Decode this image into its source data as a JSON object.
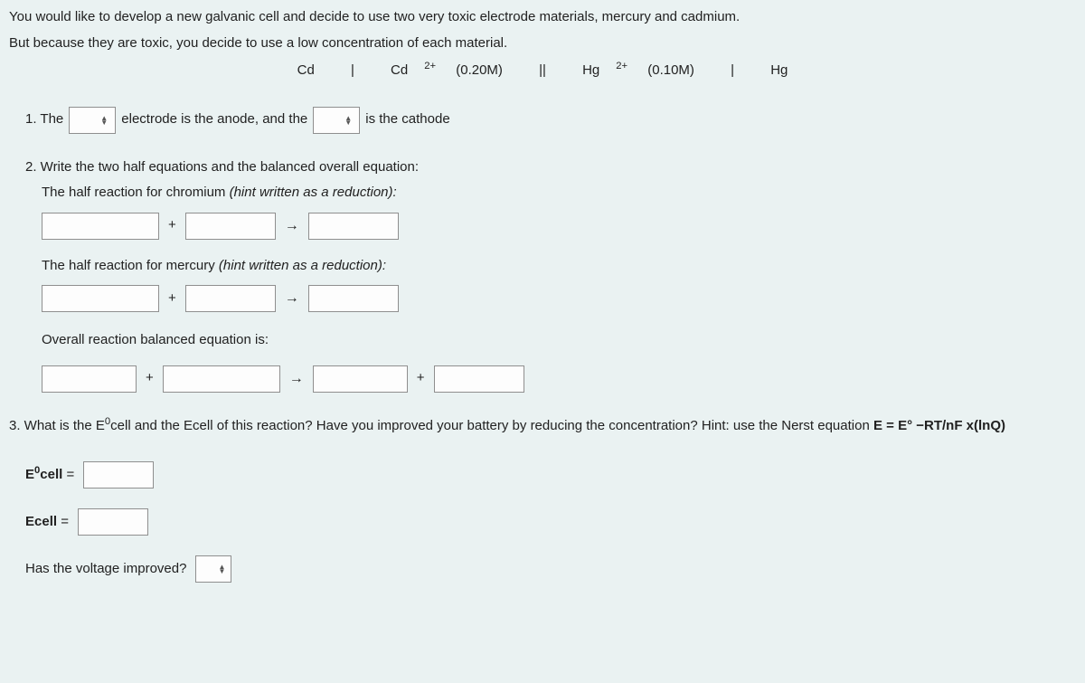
{
  "intro": {
    "line1": "You would like to develop a new galvanic cell and decide to use two very toxic electrode materials, mercury and cadmium.",
    "line2": "But because they are toxic, you decide to use a low concentration of each material."
  },
  "notation": {
    "cd": "Cd",
    "bar1": "|",
    "cd2": "Cd²⁺ (0.20M)",
    "bar2": "||",
    "hg2": "Hg²⁺ (0.10M)",
    "bar3": "|",
    "hg": "Hg"
  },
  "q1": {
    "prefix": "1. The",
    "mid": "electrode is the anode, and the",
    "suffix": "is the cathode"
  },
  "q2": {
    "title": "2. Write the two half equations and the balanced overall equation:",
    "chromium_label_a": "The half reaction for chromium ",
    "chromium_label_b": "(hint written as a reduction):",
    "mercury_label_a": "The half reaction for mercury ",
    "mercury_label_b": "(hint written as a reduction):",
    "overall_label": "Overall reaction balanced equation is:",
    "plus": "+",
    "arrow": "→"
  },
  "q3": {
    "text_a": "3. What is the E",
    "text_b": "cell and the Ecell of this reaction?  Have you improved your battery by reducing the concentration?  Hint: use the Nerst equation ",
    "text_eq": "E = E° −RT/nF x(lnQ)",
    "e0cell_label_a": "E",
    "e0cell_label_b": "cell",
    "eq": " = ",
    "ecell_label": "Ecell",
    "improved": "Has the voltage improved?"
  }
}
